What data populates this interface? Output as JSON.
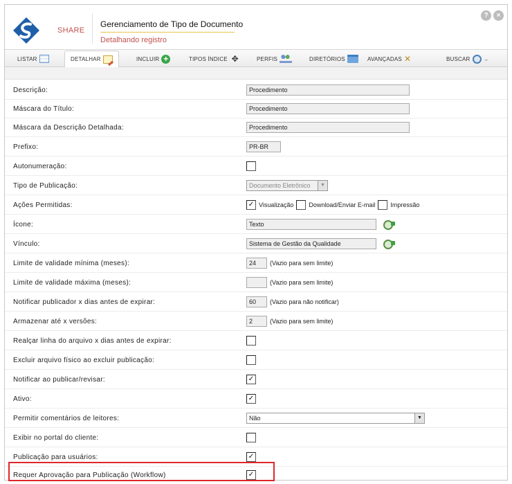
{
  "header": {
    "brand": "SHARE",
    "title": "Gerenciamento de Tipo de Documento",
    "subtitle": "Detalhando registro",
    "help": "?",
    "close": "×"
  },
  "tabs": {
    "listar": "LISTAR",
    "detalhar": "DETALHAR",
    "incluir": "INCLUIR",
    "tipos_indice": "TIPOS ÍNDICE",
    "perfis": "PERFIS",
    "diretorios": "DIRETÓRIOS",
    "avancadas": "AVANÇADAS",
    "buscar": "BUSCAR",
    "active": "detalhar"
  },
  "form": {
    "descricao": {
      "label": "Descrição:",
      "value": "Procedimento"
    },
    "mascara_titulo": {
      "label": "Máscara do Título:",
      "value": "Procedimento"
    },
    "mascara_descricao": {
      "label": "Máscara da Descrição Detalhada:",
      "value": "Procedimento"
    },
    "prefixo": {
      "label": "Prefixo:",
      "value": "PR-BR"
    },
    "autonumeracao": {
      "label": "Autonumeração:",
      "checked": false
    },
    "tipo_publicacao": {
      "label": "Tipo de Publicação:",
      "value": "Documento Eletrônico"
    },
    "acoes_permitidas": {
      "label": "Ações Permitidas:",
      "visualizacao": "Visualização",
      "visualizacao_checked": true,
      "download": "Download/Enviar E-mail",
      "download_checked": false,
      "impressao": "Impressão",
      "impressao_checked": false
    },
    "icone": {
      "label": "Ícone:",
      "value": "Texto"
    },
    "vinculo": {
      "label": "Vínculo:",
      "value": "Sistema de Gestão da Qualidade"
    },
    "validade_minima": {
      "label": "Limite de validade mínima (meses):",
      "value": "24",
      "hint": "(Vazio para sem limite)"
    },
    "validade_maxima": {
      "label": "Limite de validade máxima (meses):",
      "value": "",
      "hint": "(Vazio para sem limite)"
    },
    "notificar_dias": {
      "label": "Notificar publicador x dias antes de expirar:",
      "value": "60",
      "hint": "(Vazio para não notificar)"
    },
    "armazenar_versoes": {
      "label": "Armazenar até x versões:",
      "value": "2",
      "hint": "(Vazio para sem limite)"
    },
    "realcar_linha": {
      "label": "Realçar linha do arquivo x dias antes de expirar:",
      "checked": false
    },
    "excluir_arquivo": {
      "label": "Excluir arquivo físico ao excluir publicação:",
      "checked": false
    },
    "notificar_publicar": {
      "label": "Notificar ao publicar/revisar:",
      "checked": true
    },
    "ativo": {
      "label": "Ativo:",
      "checked": true
    },
    "comentarios": {
      "label": "Permitir comentários de leitores:",
      "value": "Não"
    },
    "portal_cliente": {
      "label": "Exibir no portal do cliente:",
      "checked": false
    },
    "publicacao_usuarios": {
      "label": "Publicação para usuários:",
      "checked": true
    },
    "requer_aprovacao": {
      "label": "Requer Aprovação para Publicação (Workflow)",
      "checked": true
    }
  },
  "colors": {
    "accent": "#c0504d",
    "highlight": "#e0262a",
    "title_underline": "#e8c34a"
  },
  "check_mark": "✓"
}
